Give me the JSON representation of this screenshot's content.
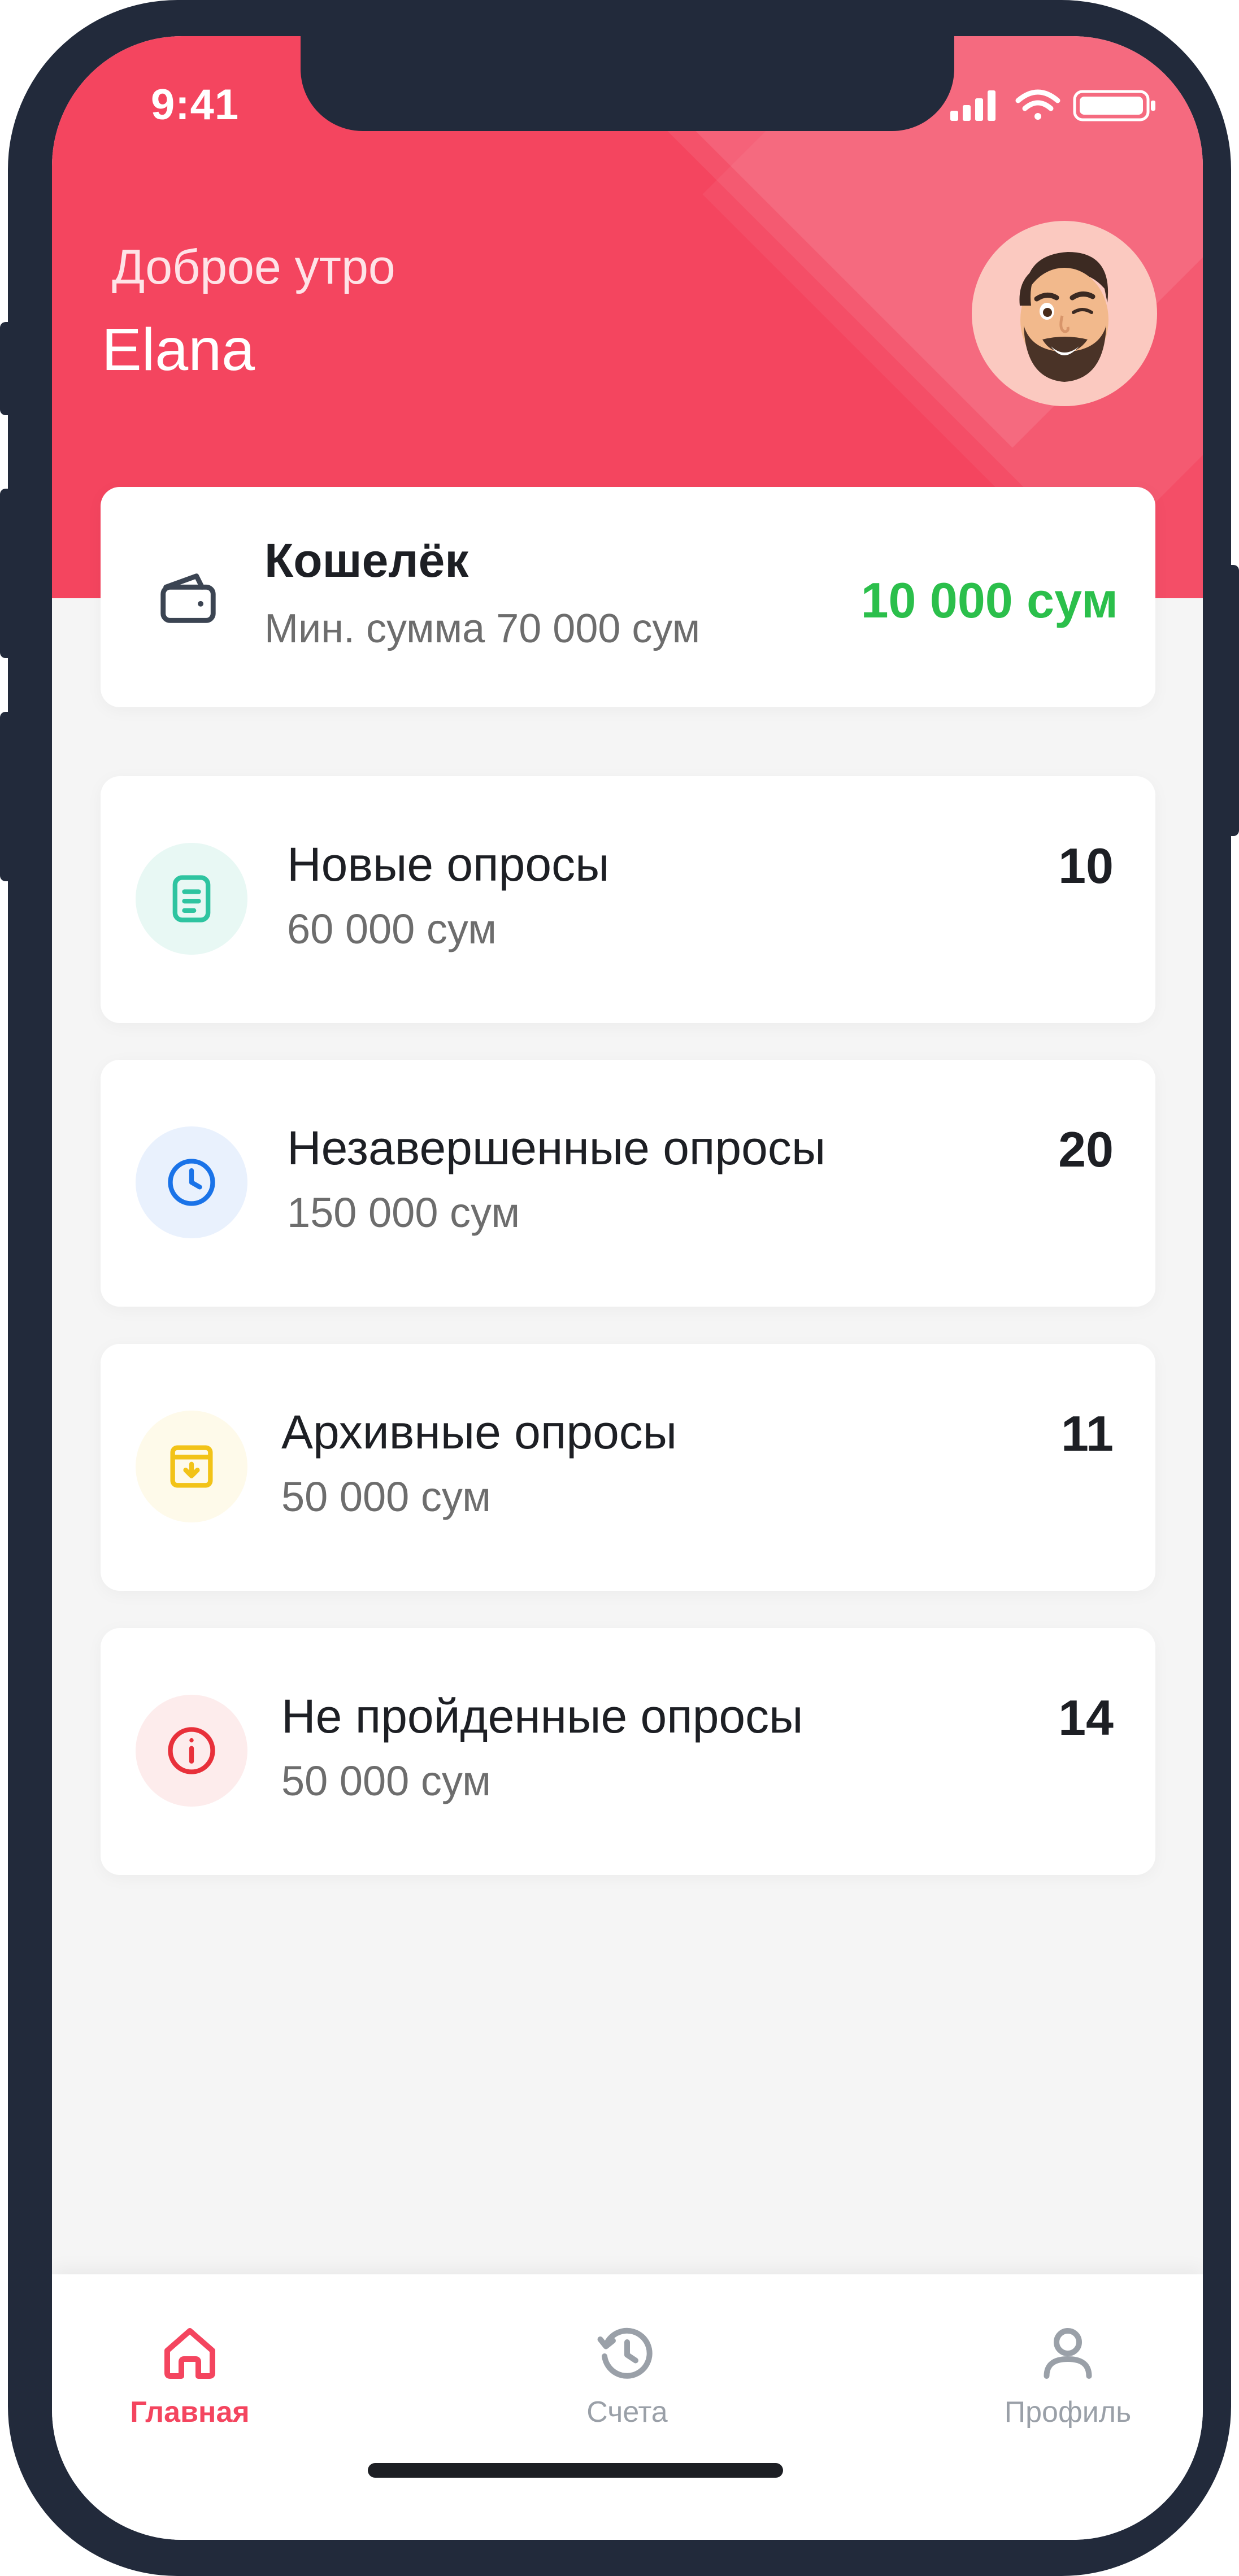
{
  "status_bar": {
    "time": "9:41"
  },
  "header": {
    "greeting": "Доброе утро",
    "user_name": "Elana",
    "bg_color": "#f4455f"
  },
  "wallet": {
    "title": "Кошелёк",
    "subtitle": "Мин. сумма 70 000 сум",
    "amount": "10 000 сум",
    "icon": "wallet-icon",
    "amount_color": "#2bbf4b"
  },
  "surveys": [
    {
      "title": "Новые опросы",
      "amount": "60 000 сум",
      "count": "10",
      "icon": "document-icon",
      "color": "#2ec4a0"
    },
    {
      "title": "Незавершенные опросы",
      "amount": "150 000 сум",
      "count": "20",
      "icon": "clock-icon",
      "color": "#1a73e8"
    },
    {
      "title": "Архивные опросы",
      "amount": "50 000 сум",
      "count": "11",
      "icon": "archive-icon",
      "color": "#f2c318"
    },
    {
      "title": "Не пройденные опросы",
      "amount": "50 000 сум",
      "count": "14",
      "icon": "info-icon",
      "color": "#e8303a"
    }
  ],
  "nav": {
    "items": [
      {
        "label": "Главная",
        "icon": "home-icon",
        "active": true
      },
      {
        "label": "Счета",
        "icon": "history-icon",
        "active": false
      },
      {
        "label": "Профиль",
        "icon": "user-icon",
        "active": false
      }
    ],
    "active_color": "#f4455f",
    "inactive_color": "#9aa0a8"
  }
}
